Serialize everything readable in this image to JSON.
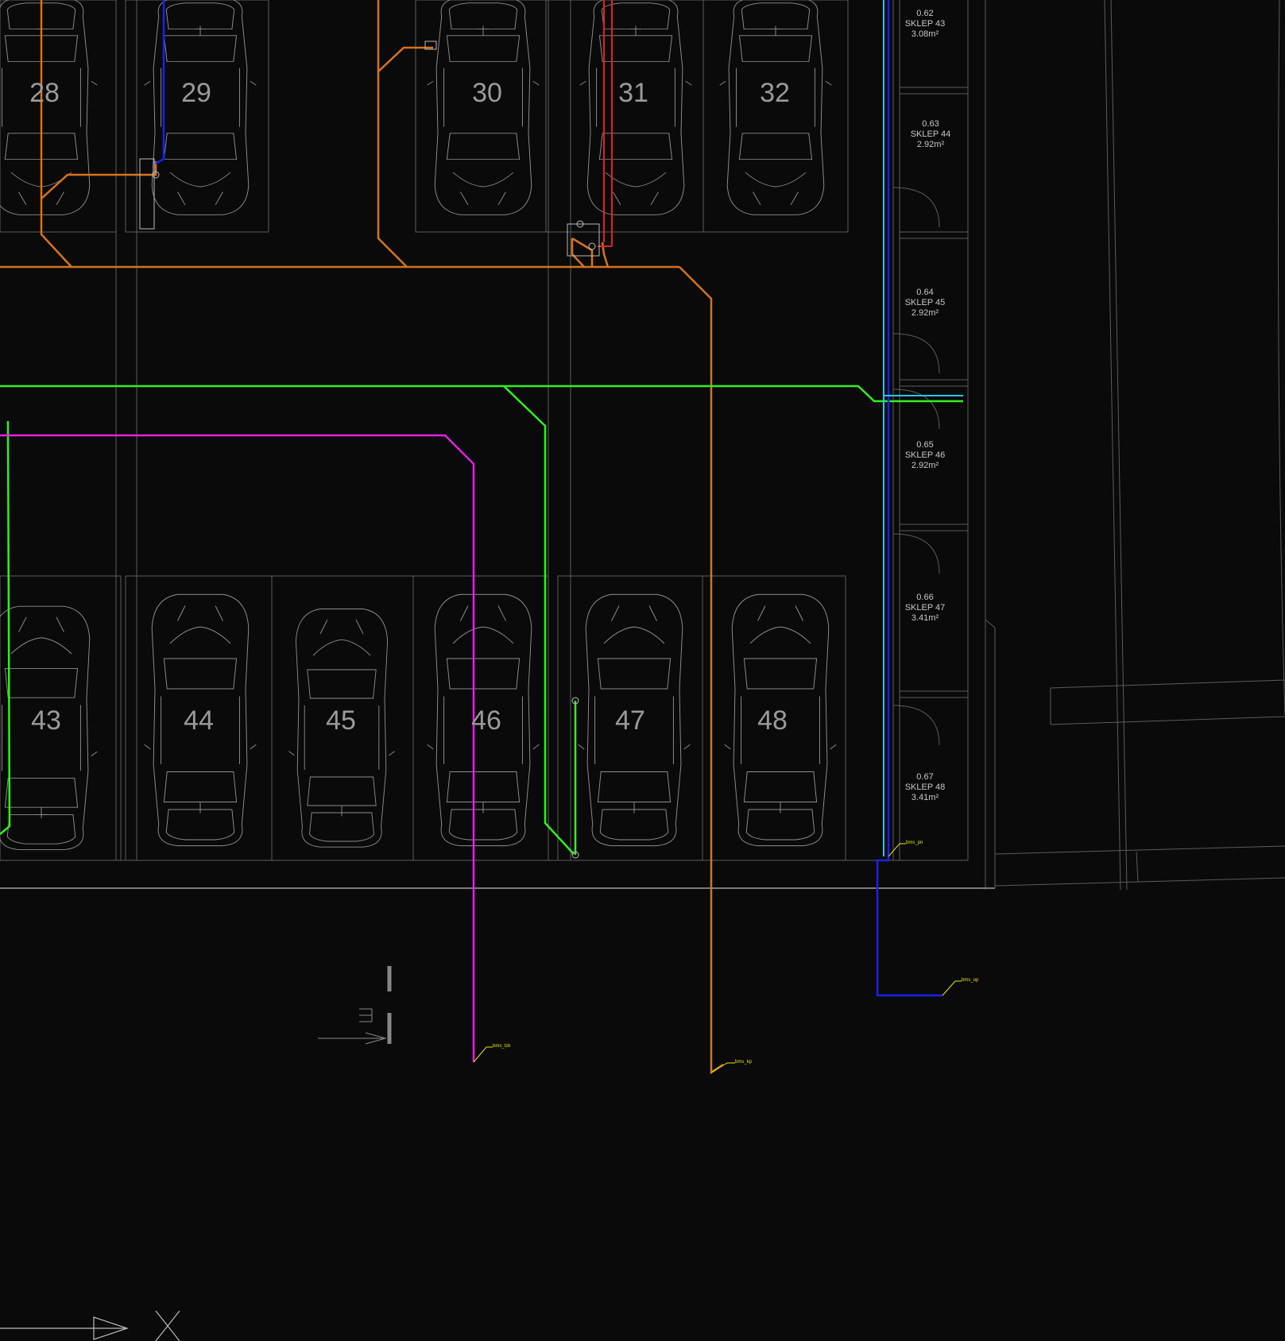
{
  "spaces_top": [
    "28",
    "29",
    "30",
    "31",
    "32"
  ],
  "spaces_bottom": [
    "43",
    "44",
    "45",
    "46",
    "47",
    "48"
  ],
  "storage_rooms": [
    {
      "code": "0.62",
      "name": "SKLEP 43",
      "area": "3.08m²"
    },
    {
      "code": "0.63",
      "name": "SKLEP 44",
      "area": "2.92m²"
    },
    {
      "code": "0.64",
      "name": "SKLEP 45",
      "area": "2.92m²"
    },
    {
      "code": "0.65",
      "name": "SKLEP 46",
      "area": "2.92m²"
    },
    {
      "code": "0.66",
      "name": "SKLEP 47",
      "area": "3.41m²"
    },
    {
      "code": "0.67",
      "name": "SKLEP 48",
      "area": "3.41m²"
    }
  ],
  "pipe_tags": {
    "tag_1": "bms_tzk",
    "tag_2": "bms_kp",
    "tag_3": "bms_op",
    "tag_4": "bms_pn"
  },
  "colors": {
    "background": "#0a0a0a",
    "orange": "#d6731e",
    "green": "#33ee22",
    "magenta": "#e022e0",
    "blue": "#1822e8",
    "cyan": "#22c8e8",
    "red": "#e02222",
    "yellow_label": "#e6e600"
  }
}
